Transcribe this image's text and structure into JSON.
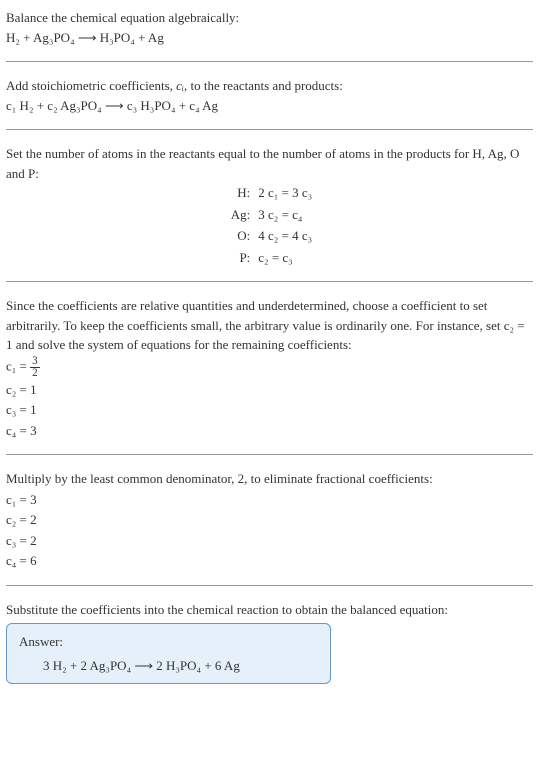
{
  "section1": {
    "title": "Balance the chemical equation algebraically:",
    "equation": "H₂ + Ag₃PO₄  ⟶  H₃PO₄ + Ag"
  },
  "section2": {
    "title_part1": "Add stoichiometric coefficients, ",
    "title_var": "cᵢ",
    "title_part2": ", to the reactants and products:",
    "equation": "c₁ H₂ + c₂ Ag₃PO₄  ⟶  c₃ H₃PO₄ + c₄ Ag"
  },
  "section3": {
    "title": "Set the number of atoms in the reactants equal to the number of atoms in the products for H, Ag, O and P:",
    "rows": [
      {
        "label": "H:",
        "eq": "2 c₁ = 3 c₃"
      },
      {
        "label": "Ag:",
        "eq": "3 c₂ = c₄"
      },
      {
        "label": "O:",
        "eq": "4 c₂ = 4 c₃"
      },
      {
        "label": "P:",
        "eq": "c₂ = c₃"
      }
    ]
  },
  "section4": {
    "text": "Since the coefficients are relative quantities and underdetermined, choose a coefficient to set arbitrarily. To keep the coefficients small, the arbitrary value is ordinarily one. For instance, set c₂ = 1 and solve the system of equations for the remaining coefficients:",
    "c1": {
      "lhs": "c₁ = ",
      "num": "3",
      "den": "2"
    },
    "c2": "c₂ = 1",
    "c3": "c₃ = 1",
    "c4": "c₄ = 3"
  },
  "section5": {
    "text": "Multiply by the least common denominator, 2, to eliminate fractional coefficients:",
    "c1": "c₁ = 3",
    "c2": "c₂ = 2",
    "c3": "c₃ = 2",
    "c4": "c₄ = 6"
  },
  "section6": {
    "text": "Substitute the coefficients into the chemical reaction to obtain the balanced equation:"
  },
  "answer": {
    "label": "Answer:",
    "equation": "3 H₂ + 2 Ag₃PO₄  ⟶  2 H₃PO₄ + 6 Ag"
  }
}
